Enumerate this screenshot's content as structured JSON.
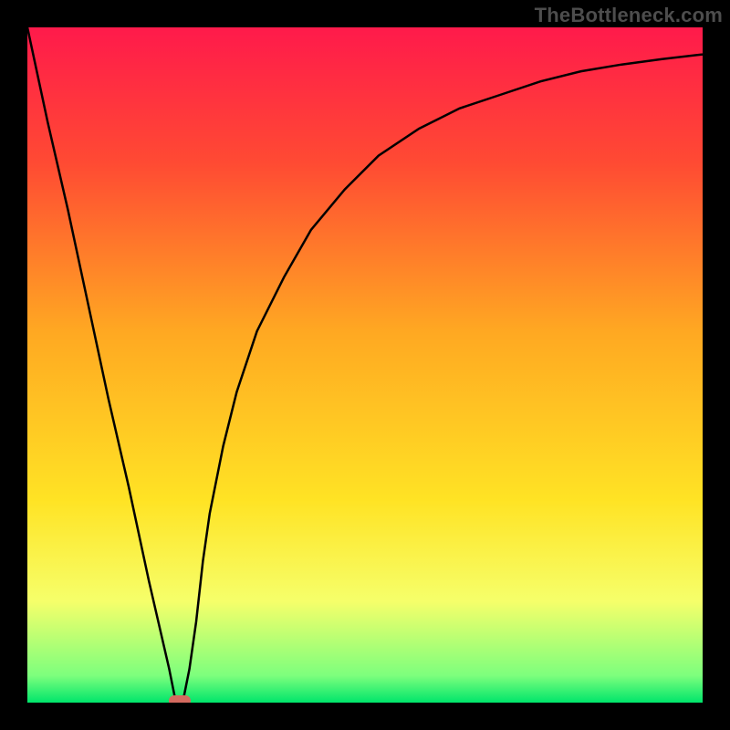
{
  "watermark": "TheBottleneck.com",
  "chart_data": {
    "type": "line",
    "title": "",
    "xlabel": "",
    "ylabel": "",
    "xlim": [
      0,
      100
    ],
    "ylim": [
      0,
      100
    ],
    "gradient_stops": [
      {
        "offset": 0,
        "color": "#ff1a4b"
      },
      {
        "offset": 20,
        "color": "#ff4a33"
      },
      {
        "offset": 45,
        "color": "#ffa822"
      },
      {
        "offset": 70,
        "color": "#ffe324"
      },
      {
        "offset": 85,
        "color": "#f6ff6a"
      },
      {
        "offset": 96,
        "color": "#7dff7d"
      },
      {
        "offset": 100,
        "color": "#00e56b"
      }
    ],
    "series": [
      {
        "name": "bottleneck-curve",
        "x": [
          0,
          3,
          6,
          9,
          12,
          15,
          18,
          21,
          22,
          23,
          24,
          25,
          26,
          27,
          29,
          31,
          34,
          38,
          42,
          47,
          52,
          58,
          64,
          70,
          76,
          82,
          88,
          94,
          100
        ],
        "values": [
          100,
          86,
          73,
          59,
          45,
          32,
          18,
          5,
          0,
          0,
          5,
          12,
          21,
          28,
          38,
          46,
          55,
          63,
          70,
          76,
          81,
          85,
          88,
          90,
          92,
          93.5,
          94.5,
          95.3,
          96
        ]
      }
    ],
    "marker": {
      "x": 22.5,
      "y": 0,
      "name": "optimal-point"
    }
  }
}
